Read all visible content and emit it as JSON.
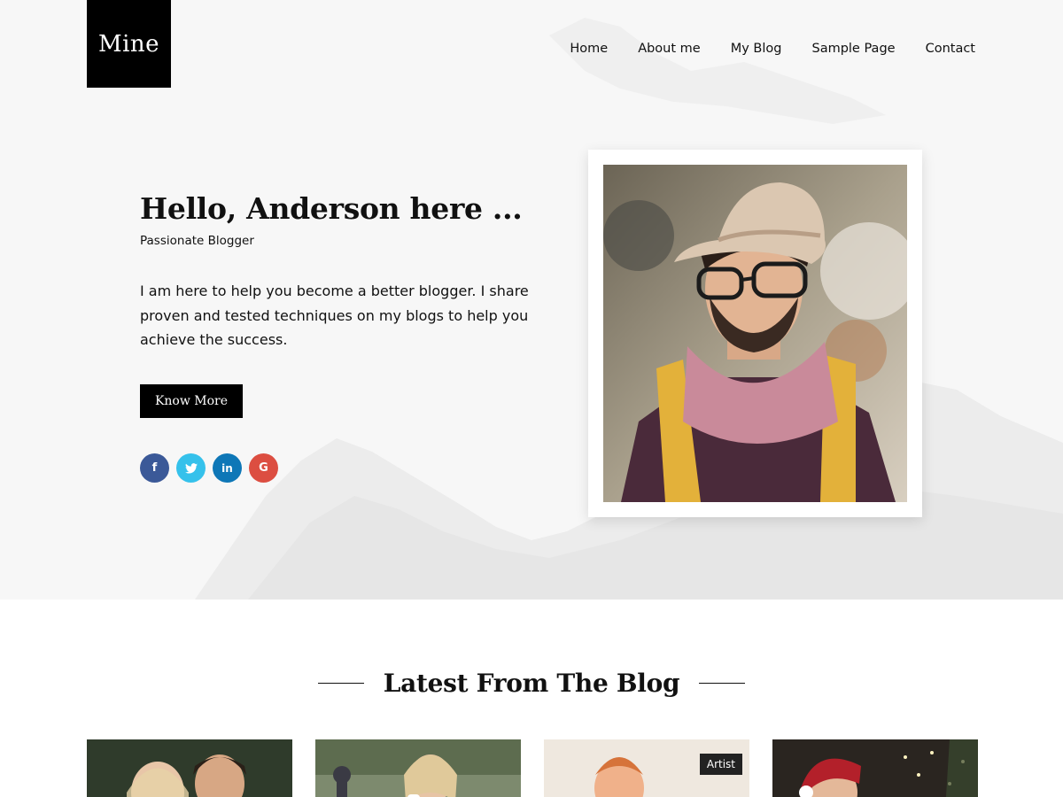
{
  "site": {
    "logo": "Mine"
  },
  "nav": {
    "items": [
      "Home",
      "About me",
      "My Blog",
      "Sample Page",
      "Contact"
    ]
  },
  "hero": {
    "greeting": "Hello, Anderson here ...",
    "subtitle": "Passionate Blogger",
    "intro": "I am here to help you become a better blogger. I share proven and tested techniques on my blogs to help you achieve the success.",
    "button_label": "Know More",
    "socials": [
      {
        "name": "facebook-icon",
        "glyph": "f",
        "color": "#3b5998"
      },
      {
        "name": "twitter-icon",
        "glyph": "t",
        "color": "#35c1eb"
      },
      {
        "name": "linkedin-icon",
        "glyph": "in",
        "color": "#0e77b7"
      },
      {
        "name": "google-plus-icon",
        "glyph": "G",
        "color": "#dc4e41"
      }
    ]
  },
  "blog": {
    "title": "Latest From The Blog",
    "cards": [
      {
        "badge": ""
      },
      {
        "badge": ""
      },
      {
        "badge": "Artist"
      },
      {
        "badge": ""
      }
    ]
  }
}
